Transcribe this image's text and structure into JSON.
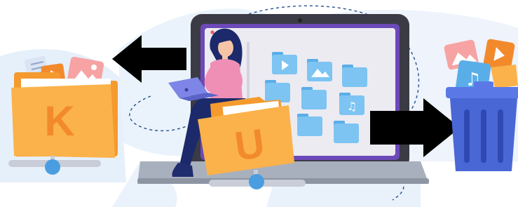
{
  "left_folder": {
    "letter": "K"
  },
  "center_folder": {
    "letter": "U"
  },
  "colors": {
    "folder": "#fbb24a",
    "folder_back": "#f49a2e",
    "folder_letter": "#f28a2c",
    "screen_folder": "#7dc4f2",
    "trash": "#4a67d6",
    "trash_lid": "#5a78e6",
    "screen_frame": "#3b3b46",
    "screen_inner": "#6c49b8",
    "arrow": "#000000",
    "node": "#4a9de0",
    "woman_top": "#ef8fb6",
    "woman_pants": "#1c2a6b"
  },
  "icons": [
    "image-icon",
    "music-icon",
    "video-icon",
    "document-icon"
  ]
}
